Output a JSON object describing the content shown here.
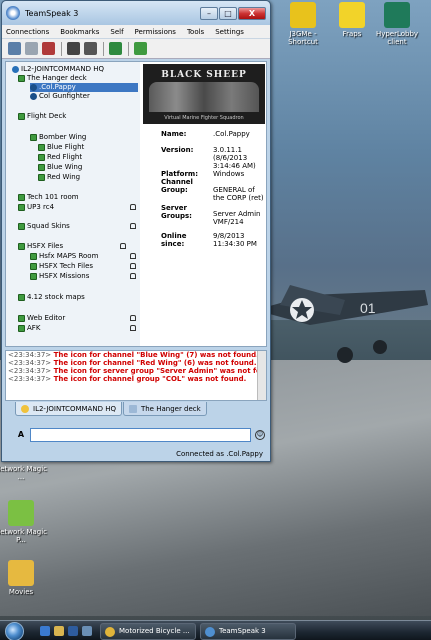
{
  "window": {
    "title": "TeamSpeak 3",
    "controls": {
      "minimize": "–",
      "maximize": "□",
      "close": "X"
    }
  },
  "menu": [
    "Connections",
    "Bookmarks",
    "Self",
    "Permissions",
    "Tools",
    "Settings"
  ],
  "toolbar_icons": [
    "connect-icon",
    "disconnect-icon",
    "away-icon",
    "mute-microphone-icon",
    "mute-speakers-icon",
    "whisper-icon",
    "contacts-icon"
  ],
  "tree": {
    "server": "IL2-JOINTCOMMAND HQ",
    "items": [
      {
        "label": "The Hanger deck",
        "type": "channel"
      },
      {
        "label": ".Col.Pappy",
        "type": "user",
        "selected": true
      },
      {
        "label": "Col Gunfighter",
        "type": "user"
      },
      {
        "label": "Flight Deck",
        "type": "channel"
      },
      {
        "label": "Bomber Wing",
        "type": "channel"
      },
      {
        "label": "Blue Flight",
        "type": "channel"
      },
      {
        "label": "Red Flight",
        "type": "channel"
      },
      {
        "label": "Blue Wing",
        "type": "channel"
      },
      {
        "label": "Red Wing",
        "type": "channel"
      },
      {
        "label": "Tech 101 room",
        "type": "channel"
      },
      {
        "label": "UP3 rc4",
        "type": "channel"
      },
      {
        "label": "Squad Skins",
        "type": "channel"
      },
      {
        "label": "HSFX Files",
        "type": "channel"
      },
      {
        "label": "Hsfx MAPS Room",
        "type": "channel"
      },
      {
        "label": "HSFX Tech Files",
        "type": "channel"
      },
      {
        "label": "HSFX Missions",
        "type": "channel"
      },
      {
        "label": "4.12 stock maps",
        "type": "channel"
      },
      {
        "label": "Web Editor",
        "type": "channel"
      },
      {
        "label": "AFK",
        "type": "channel"
      }
    ]
  },
  "banner": {
    "title": "BLACK SHEEP",
    "subtitle": "Virtual Marine Fighter Squadron"
  },
  "info": {
    "name_label": "Name:",
    "name_value": ".Col.Pappy",
    "version_label": "Version:",
    "version_value": "3.0.11.1 (8/6/2013 3:14:46 AM)",
    "platform_label": "Platform:",
    "platform_value": "Windows",
    "channel_group_label": "Channel Group:",
    "channel_group_value": "GENERAL of the CORP (ret)",
    "server_groups_label": "Server Groups:",
    "server_groups_value": "Server Admin VMF/214",
    "online_since_label": "Online since:",
    "online_since_value": "9/8/2013 11:34:30 PM"
  },
  "chat": [
    {
      "time": "<23:34:37>",
      "text": "The icon for channel \"Blue Wing\" (7) was not found."
    },
    {
      "time": "<23:34:37>",
      "text": "The icon for channel \"Red Wing\" (6) was not found."
    },
    {
      "time": "<23:34:37>",
      "text": "The icon for server group \"Server Admin\" was not found."
    },
    {
      "time": "<23:34:37>",
      "text": "The icon for channel group \"COL\" was not found."
    }
  ],
  "tabs": [
    "IL2-JOINTCOMMAND HQ",
    "The Hanger deck"
  ],
  "chat_input": {
    "value": "",
    "format_label": "A"
  },
  "status": {
    "text": "Connected as .Col.Pappy"
  },
  "desktop_icons": [
    {
      "label": "J3GMe - Shortcut",
      "name": "j3gme-shortcut-icon",
      "color": "#e8c21c"
    },
    {
      "label": "Fraps",
      "name": "fraps-icon",
      "color": "#f2d329"
    },
    {
      "label": "HyperLobby client",
      "name": "hyperlobby-icon",
      "color": "#1f7a5a"
    },
    {
      "label": "Network Magic ...",
      "name": "network-magic-icon",
      "color": "#2f86d6"
    },
    {
      "label": "Network Magic P...",
      "name": "network-magic-p-icon",
      "color": "#7bc043"
    },
    {
      "label": "Movies",
      "name": "movies-folder-icon",
      "color": "#e6b940"
    }
  ],
  "taskbar": {
    "items": [
      {
        "label": "Motorized Bicycle ...",
        "name": "taskbar-chrome",
        "color": "#e0b43a"
      },
      {
        "label": "TeamSpeak 3",
        "name": "taskbar-teamspeak",
        "color": "#4f8fd0"
      }
    ]
  },
  "colors": {
    "error_text": "#d00000",
    "selection": "#3d77c3",
    "channel_icon": "#3f9a3f"
  }
}
